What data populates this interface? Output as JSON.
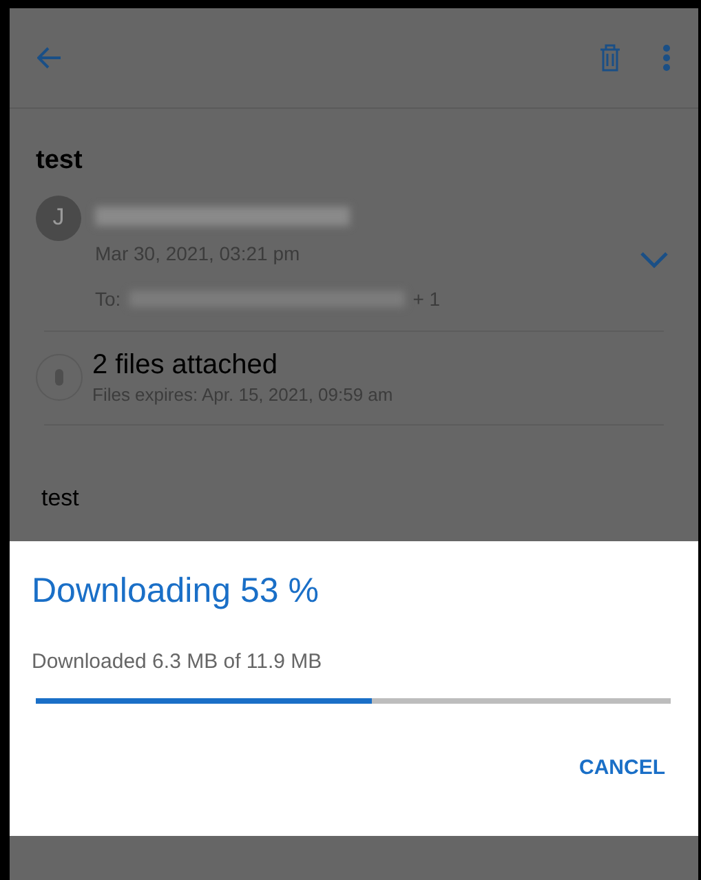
{
  "message": {
    "subject": "test",
    "avatar_letter": "J",
    "date": "Mar 30, 2021, 03:21 pm",
    "to_label": "To:",
    "to_extra": "+ 1",
    "expanded": false
  },
  "attachments": {
    "title": "2 files attached",
    "expiry": "Files expires: Apr. 15, 2021, 09:59 am"
  },
  "body": "test",
  "dialog": {
    "title": "Downloading 53 %",
    "detail": "Downloaded 6.3 MB of 11.9 MB",
    "level": 0.53,
    "button": "CANCEL"
  }
}
